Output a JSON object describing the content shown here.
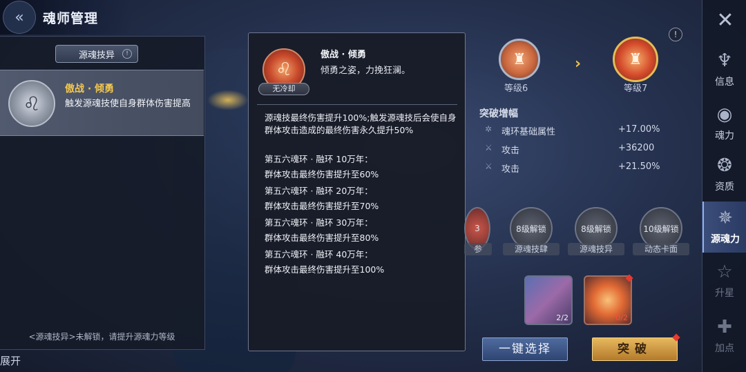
{
  "header": {
    "back_icon": "double-chevron-left-icon",
    "title": "魂师管理"
  },
  "left_panel": {
    "section_tab": "源魂技异",
    "section_info": "!",
    "skill": {
      "name": "傲战 · 倾勇",
      "description": "触发源魂技使自身群体伤害提高"
    },
    "unlock_hint": "<源魂技异>未解锁，请提升源魂力等级",
    "expand_label": "展开"
  },
  "tooltip": {
    "badge": "无冷却",
    "name": "傲战 · 倾勇",
    "motto": "倾勇之姿，力挽狂澜。",
    "effect": "源魂技最终伤害提升100%;触发源魂技后会使自身群体攻击造成的最终伤害永久提升50%",
    "tiers": [
      {
        "title": "第五六魂环 · 融环 10万年：",
        "desc": "群体攻击最终伤害提升至60%"
      },
      {
        "title": "第五六魂环 · 融环 20万年：",
        "desc": "群体攻击最终伤害提升至70%"
      },
      {
        "title": "第五六魂环 · 融环 30万年：",
        "desc": "群体攻击最终伤害提升至80%"
      },
      {
        "title": "第五六魂环 · 融环 40万年：",
        "desc": "群体攻击最终伤害提升至100%"
      }
    ]
  },
  "levels": {
    "current": "等级6",
    "next": "等级7",
    "info": "!"
  },
  "bonus": {
    "title": "突破增幅",
    "rows": [
      {
        "name": "魂环基础属性",
        "value": "+17.00%"
      },
      {
        "name": "攻击",
        "value": "+36200"
      },
      {
        "name": "攻击",
        "value": "+21.50%"
      }
    ]
  },
  "features": [
    {
      "count": "3",
      "label": "参"
    },
    {
      "lock": "8级解锁",
      "label": "源魂技肆"
    },
    {
      "lock": "8级解锁",
      "label": "源魂技异"
    },
    {
      "lock": "10级解锁",
      "label": "动态卡面"
    }
  ],
  "cards": [
    {
      "count": "2/2"
    },
    {
      "count": "0/2"
    }
  ],
  "buttons": {
    "select": "一键选择",
    "breakthrough": "突破"
  },
  "sidebar": {
    "items": [
      {
        "label": "信息",
        "icon": "info-emblem-icon"
      },
      {
        "label": "魂力",
        "icon": "soul-power-icon"
      },
      {
        "label": "资质",
        "icon": "aptitude-icon"
      },
      {
        "label": "源魂力",
        "icon": "source-soul-icon"
      },
      {
        "label": "升星",
        "icon": "star-icon"
      },
      {
        "label": "加点",
        "icon": "plus-point-icon"
      }
    ]
  },
  "colors": {
    "gold": "#f3c74f",
    "accent_blue": "#8fb2ff",
    "red_dot": "#e43a2f"
  }
}
